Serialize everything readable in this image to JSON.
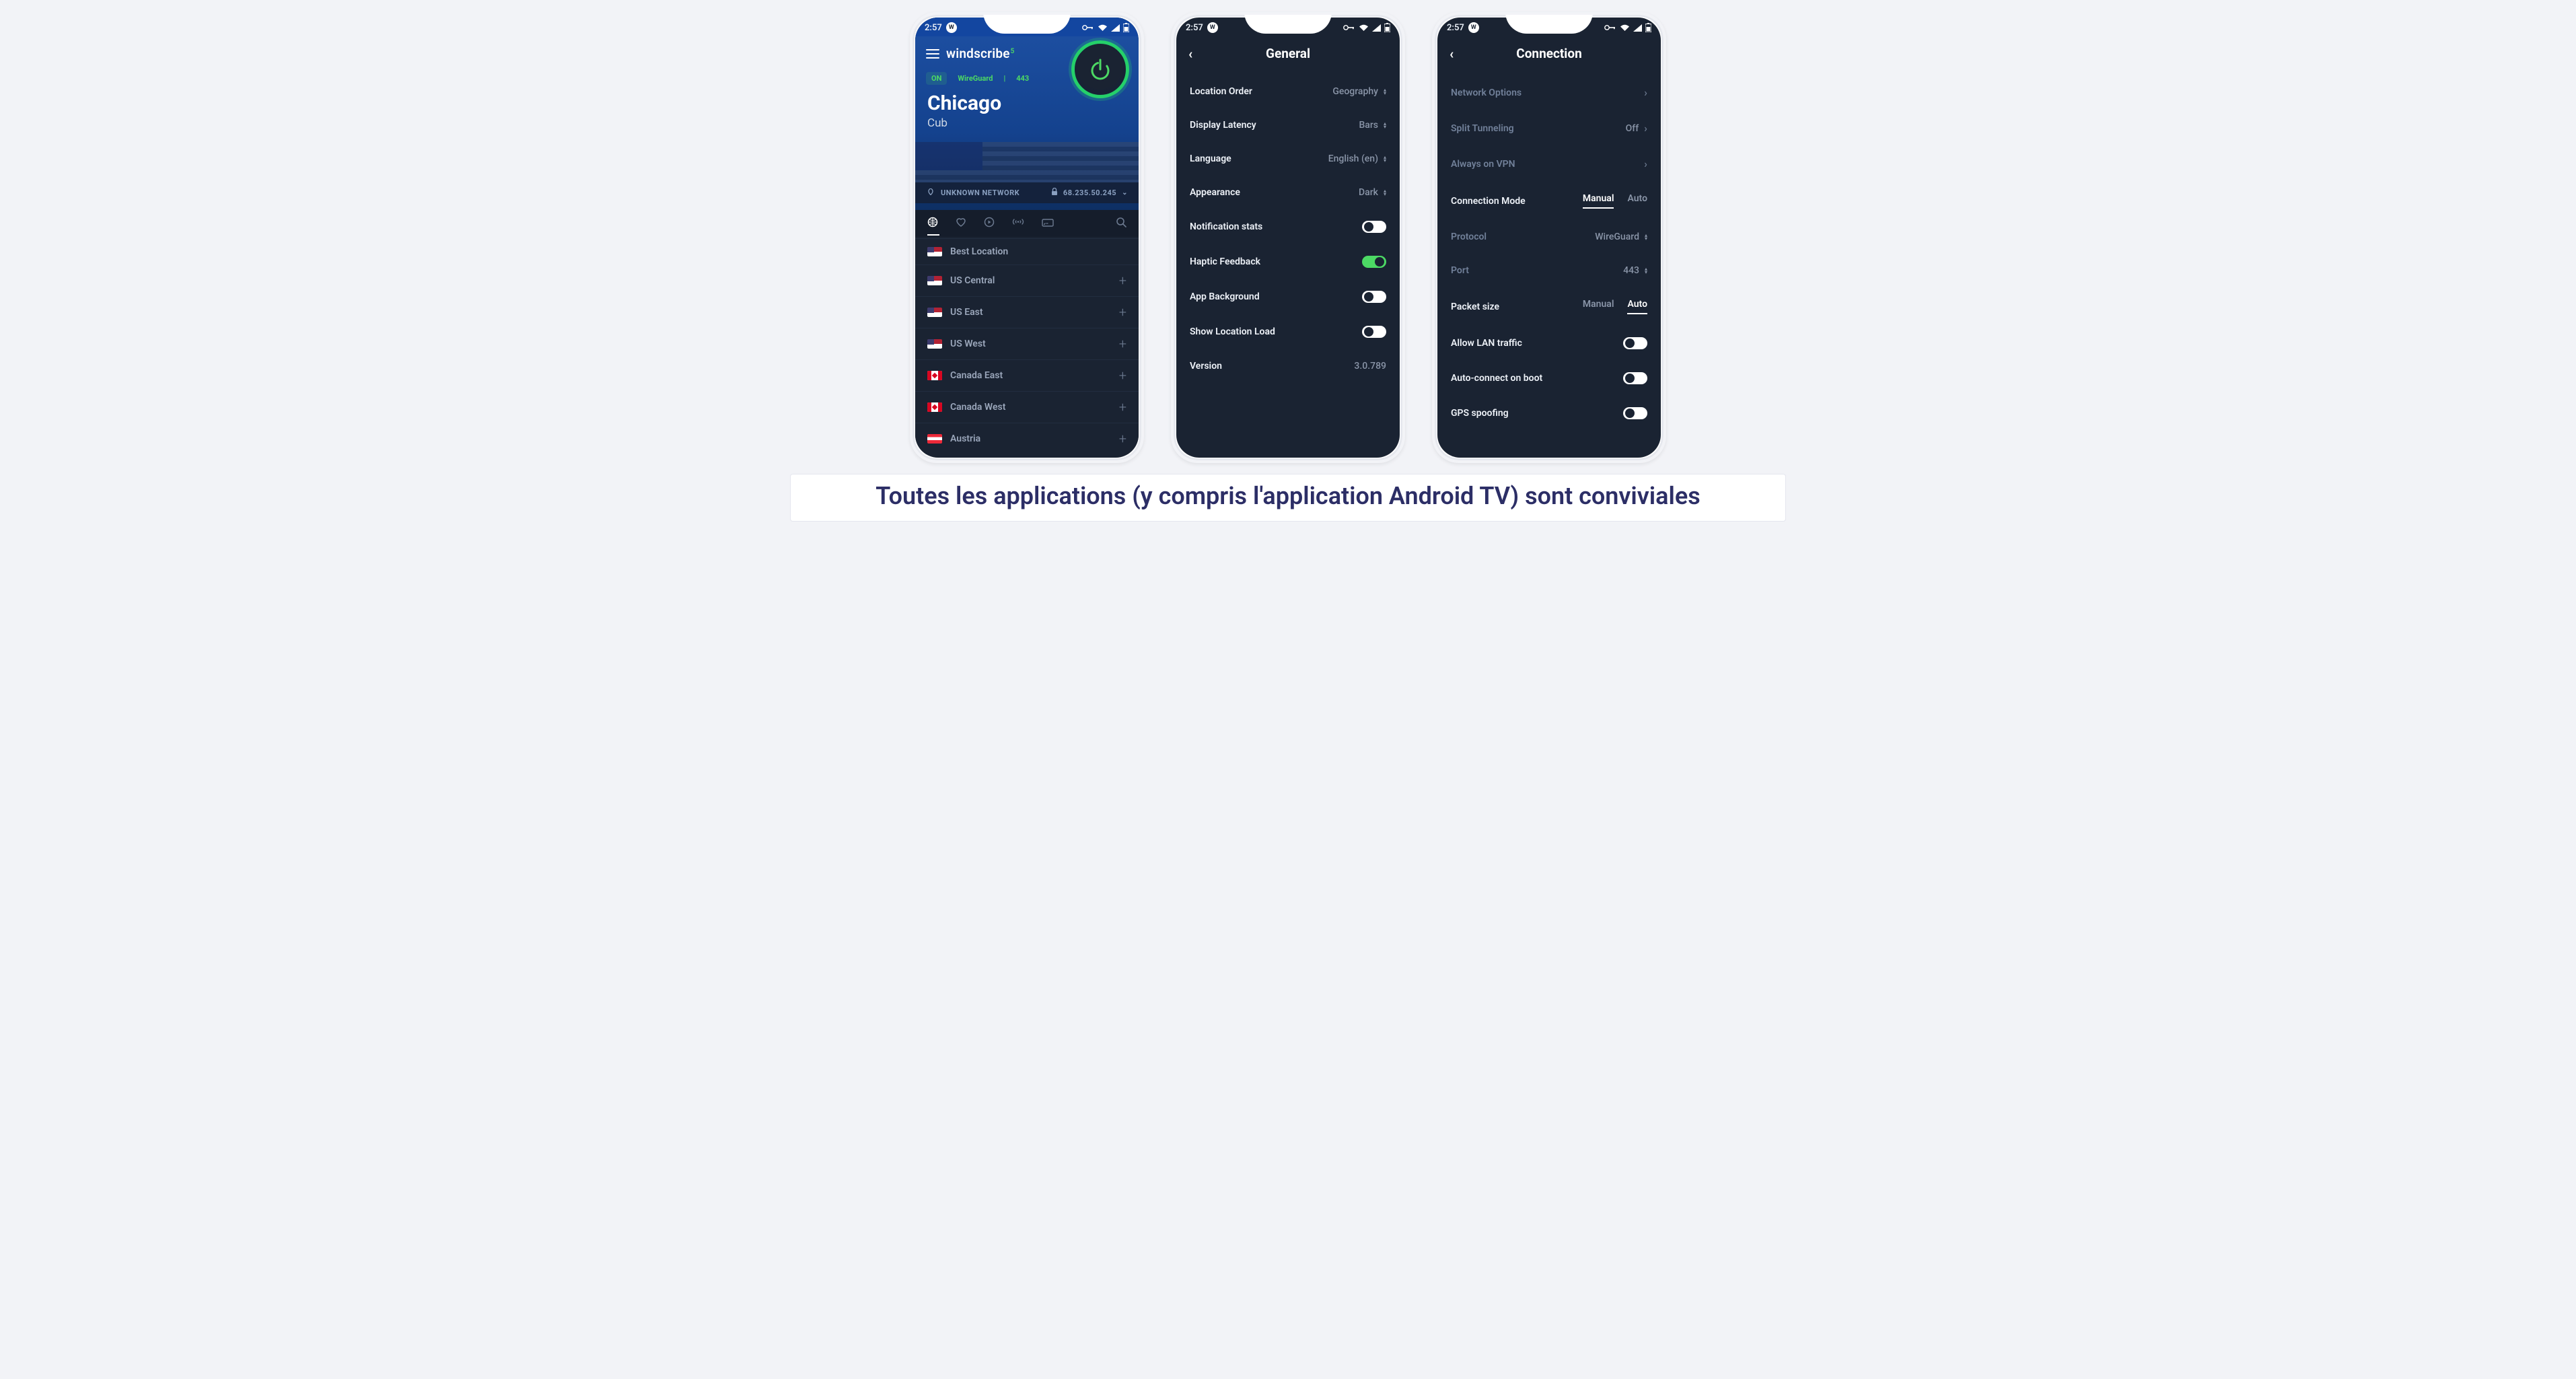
{
  "statusbar": {
    "time": "2:57"
  },
  "phone1": {
    "brand": "windscribe",
    "badge_num": "5",
    "chip_on": "ON",
    "chip_proto": "WireGuard",
    "chip_port": "443",
    "city": "Chicago",
    "sub": "Cub",
    "network_label": "UNKNOWN NETWORK",
    "ip": "68.235.50.245",
    "locations": [
      {
        "flag": "us",
        "name": "Best Location",
        "expandable": false
      },
      {
        "flag": "us",
        "name": "US Central",
        "expandable": true
      },
      {
        "flag": "us",
        "name": "US East",
        "expandable": true
      },
      {
        "flag": "us",
        "name": "US West",
        "expandable": true
      },
      {
        "flag": "ca",
        "name": "Canada East",
        "expandable": true
      },
      {
        "flag": "ca",
        "name": "Canada West",
        "expandable": true
      },
      {
        "flag": "at",
        "name": "Austria",
        "expandable": true
      }
    ]
  },
  "phone2": {
    "title": "General",
    "rows": [
      {
        "label": "Location Order",
        "value": "Geography",
        "type": "select"
      },
      {
        "label": "Display Latency",
        "value": "Bars",
        "type": "select"
      },
      {
        "label": "Language",
        "value": "English (en)",
        "type": "select"
      },
      {
        "label": "Appearance",
        "value": "Dark",
        "type": "select"
      },
      {
        "label": "Notification stats",
        "type": "toggle",
        "on": false
      },
      {
        "label": "Haptic Feedback",
        "type": "toggle",
        "on": true
      },
      {
        "label": "App Background",
        "type": "toggle",
        "on": false
      },
      {
        "label": "Show Location Load",
        "type": "toggle",
        "on": false
      },
      {
        "label": "Version",
        "value": "3.0.789",
        "type": "text"
      }
    ]
  },
  "phone3": {
    "title": "Connection",
    "nav_rows": [
      {
        "label": "Network Options"
      },
      {
        "label": "Split Tunneling",
        "value": "Off"
      },
      {
        "label": "Always on VPN"
      }
    ],
    "conn_mode_label": "Connection Mode",
    "conn_mode_opts": [
      "Manual",
      "Auto"
    ],
    "conn_mode_active": "Manual",
    "protocol_label": "Protocol",
    "protocol_value": "WireGuard",
    "port_label": "Port",
    "port_value": "443",
    "packet_label": "Packet size",
    "packet_opts": [
      "Manual",
      "Auto"
    ],
    "packet_active": "Auto",
    "toggles": [
      {
        "label": "Allow LAN traffic",
        "on": false
      },
      {
        "label": "Auto-connect on boot",
        "on": false
      },
      {
        "label": "GPS spoofing",
        "on": false
      }
    ]
  },
  "caption": "Toutes les applications (y compris l'application Android TV) sont conviviales"
}
